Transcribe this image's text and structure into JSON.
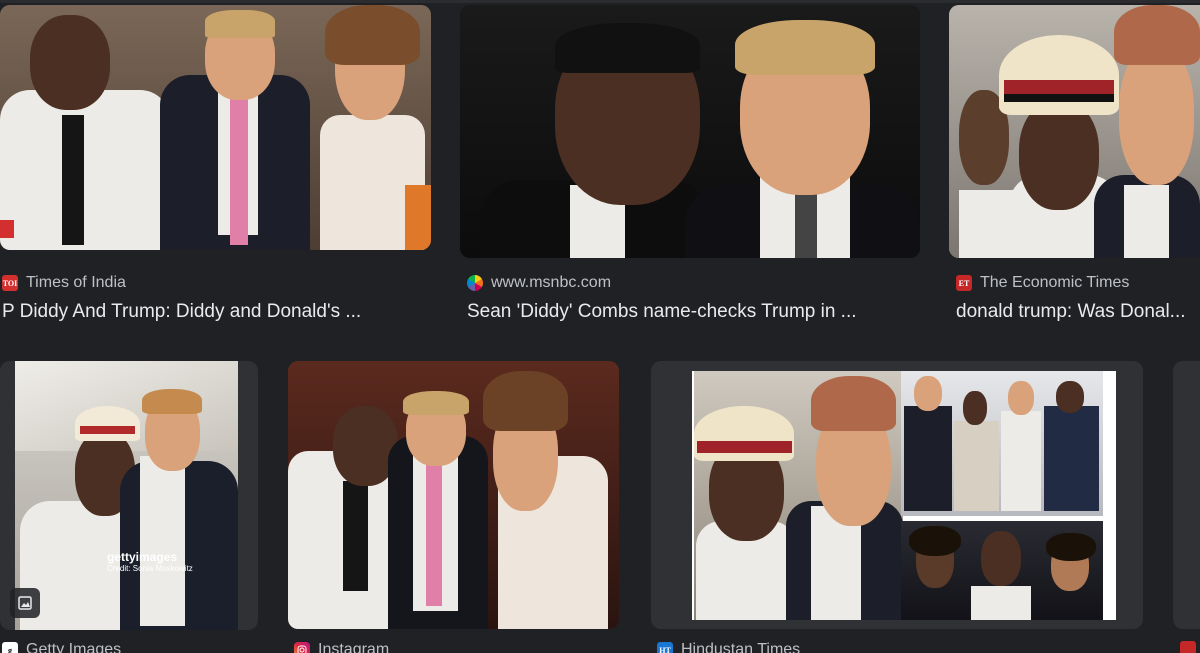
{
  "results": [
    {
      "source": "Times of India",
      "favicon_text": "TOI",
      "favicon_color": "#d32f2f",
      "title": "P Diddy And Trump: Diddy and Donald's ..."
    },
    {
      "source": "www.msnbc.com",
      "favicon_text": "",
      "favicon_color": "#ffffff",
      "title": "Sean 'Diddy' Combs name-checks Trump in ..."
    },
    {
      "source": "The Economic Times",
      "favicon_text": "ET",
      "favicon_color": "#c62828",
      "title": "donald trump: Was Donal..."
    },
    {
      "source": "Getty Images",
      "favicon_text": "g",
      "favicon_color": "#ffffff",
      "watermark": "gettyimages",
      "watermark_credit": "Credit: Sonia Moskowitz"
    },
    {
      "source": "Instagram",
      "favicon_text": "",
      "favicon_color": "#d6249f"
    },
    {
      "source": "Hindustan Times",
      "favicon_text": "HT",
      "favicon_color": "#1976d2"
    },
    {
      "source": "",
      "favicon_text": "",
      "favicon_color": "#c62828"
    }
  ]
}
